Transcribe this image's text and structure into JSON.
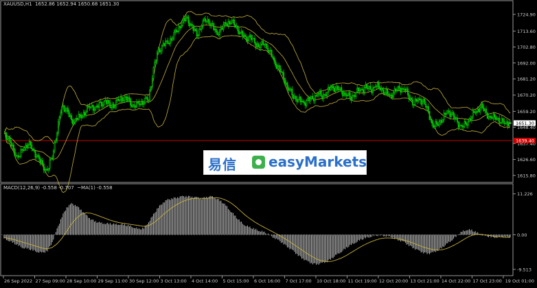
{
  "header": {
    "main_title": "XAUUSD,H1  1652.86 1652.94 1650.68 1651.30",
    "macd_title": "MACD(12,26,9) -0.558 -0.707  ~MA(1) -0.558"
  },
  "colors": {
    "background": "#000000",
    "bull_candle": "#00d000",
    "bear_candle": "#006400",
    "bollinger": "#c8b43c",
    "macd_histogram": "#c8c8c8",
    "macd_signal": "#c8b43c",
    "level_line": "#c80000",
    "price_tag": "#ffffff",
    "level_tag": "#d00000"
  },
  "logo": {
    "text_cn": "易信",
    "text_en": "easyMarkets",
    "mark_icon": "easymarkets-logo-icon"
  },
  "chart_data": [
    {
      "type": "candlestick",
      "title": "XAUUSD,H1",
      "ohlc_last": {
        "open": 1652.86,
        "high": 1652.94,
        "low": 1650.68,
        "close": 1651.3
      },
      "y_ticks": [
        "1724.90",
        "1713.60",
        "1702.80",
        "1692.00",
        "1681.20",
        "1670.20",
        "1659.20",
        "1648.40",
        "1637.40",
        "1626.60",
        "1615.80"
      ],
      "ylim": [
        1612,
        1730
      ],
      "x_ticks": [
        "26 Sep 2022",
        "27 Sep 09:00",
        "28 Sep 10:00",
        "29 Sep 11:00",
        "30 Sep 12:00",
        "3 Oct 13:00",
        "4 Oct 14:00",
        "5 Oct 15:00",
        "6 Oct 16:00",
        "7 Oct 17:00",
        "10 Oct 18:00",
        "11 Oct 19:00",
        "12 Oct 20:00",
        "13 Oct 21:00",
        "14 Oct 22:00",
        "17 Oct 23:00",
        "19 Oct 01:00"
      ],
      "current_price_label": "1651.30",
      "level_label": "1639.40",
      "level_price": 1639.4,
      "close_path": [
        1645,
        1640,
        1632,
        1628,
        1634,
        1638,
        1633,
        1628,
        1622,
        1619,
        1629,
        1646,
        1663,
        1660,
        1652,
        1654,
        1656,
        1660,
        1663,
        1661,
        1664,
        1666,
        1663,
        1664,
        1668,
        1668,
        1666,
        1662,
        1665,
        1666,
        1668,
        1688,
        1700,
        1704,
        1706,
        1710,
        1715,
        1720,
        1722,
        1716,
        1711,
        1718,
        1722,
        1718,
        1712,
        1714,
        1719,
        1720,
        1718,
        1712,
        1709,
        1709,
        1706,
        1703,
        1706,
        1700,
        1693,
        1688,
        1682,
        1674,
        1670,
        1667,
        1665,
        1666,
        1668,
        1671,
        1670,
        1672,
        1676,
        1674,
        1673,
        1670,
        1669,
        1672,
        1674,
        1675,
        1674,
        1676,
        1676,
        1672,
        1670,
        1672,
        1675,
        1674,
        1670,
        1664,
        1668,
        1665,
        1659,
        1648,
        1652,
        1654,
        1660,
        1656,
        1652,
        1648,
        1652,
        1656,
        1660,
        1662,
        1658,
        1654,
        1656,
        1652,
        1652,
        1651
      ]
    },
    {
      "type": "macd",
      "title": "MACD(12,26,9)",
      "macd_value": -0.558,
      "signal_value": -0.707,
      "y_ticks": [
        "11.226",
        "0.00",
        "-9.513"
      ],
      "ylim": [
        -10.5,
        12.3
      ],
      "histogram": [
        -1.0,
        -1.6,
        -2.3,
        -3.0,
        -3.6,
        -3.9,
        -4.3,
        -4.7,
        -5.0,
        -4.4,
        -2.0,
        1.5,
        5.0,
        7.5,
        8.5,
        8.0,
        6.8,
        5.4,
        4.3,
        3.6,
        3.2,
        3.1,
        3.0,
        2.8,
        2.9,
        2.7,
        2.4,
        2.0,
        1.5,
        1.8,
        3.5,
        5.5,
        7.5,
        8.9,
        9.6,
        10.0,
        10.3,
        10.5,
        10.6,
        10.4,
        10.2,
        10.0,
        10.3,
        10.5,
        10.0,
        9.2,
        8.0,
        6.5,
        5.0,
        3.6,
        2.6,
        2.0,
        1.5,
        1.1,
        0.6,
        0.0,
        -0.8,
        -1.6,
        -2.5,
        -3.5,
        -4.5,
        -5.6,
        -6.6,
        -7.4,
        -7.9,
        -8.1,
        -7.8,
        -7.3,
        -6.5,
        -5.5,
        -4.6,
        -3.6,
        -2.8,
        -2.0,
        -1.4,
        -0.9,
        -0.5,
        -0.3,
        -0.1,
        -0.3,
        -0.6,
        -1.0,
        -1.5,
        -2.1,
        -2.9,
        -3.7,
        -4.4,
        -4.9,
        -5.2,
        -4.9,
        -4.2,
        -3.4,
        -2.4,
        -1.3,
        -0.2,
        0.8,
        1.4,
        1.2,
        0.6,
        0.0,
        -0.4,
        -0.6,
        -0.7,
        -0.6,
        -0.6,
        -0.6
      ],
      "signal": [
        -0.8,
        -1.0,
        -1.3,
        -1.7,
        -2.1,
        -2.5,
        -2.9,
        -3.3,
        -3.7,
        -3.9,
        -3.5,
        -2.5,
        -1.0,
        1.0,
        3.0,
        4.5,
        5.6,
        6.0,
        5.9,
        5.5,
        5.0,
        4.5,
        4.0,
        3.6,
        3.3,
        3.1,
        2.9,
        2.7,
        2.5,
        2.3,
        2.5,
        3.2,
        4.3,
        5.5,
        6.6,
        7.6,
        8.4,
        9.1,
        9.6,
        9.9,
        10.0,
        10.0,
        10.0,
        10.1,
        10.2,
        10.0,
        9.5,
        8.8,
        7.8,
        6.6,
        5.4,
        4.4,
        3.5,
        2.7,
        2.0,
        1.3,
        0.6,
        -0.1,
        -0.9,
        -1.7,
        -2.6,
        -3.5,
        -4.4,
        -5.3,
        -6.1,
        -6.8,
        -7.2,
        -7.4,
        -7.3,
        -6.9,
        -6.4,
        -5.7,
        -4.9,
        -4.1,
        -3.3,
        -2.6,
        -2.0,
        -1.5,
        -1.1,
        -0.9,
        -0.9,
        -1.0,
        -1.2,
        -1.5,
        -1.9,
        -2.4,
        -2.9,
        -3.4,
        -3.8,
        -4.1,
        -4.2,
        -4.1,
        -3.7,
        -3.1,
        -2.4,
        -1.6,
        -0.8,
        -0.2,
        0.1,
        0.1,
        -0.1,
        -0.3,
        -0.5,
        -0.6,
        -0.7,
        -0.7
      ]
    }
  ]
}
